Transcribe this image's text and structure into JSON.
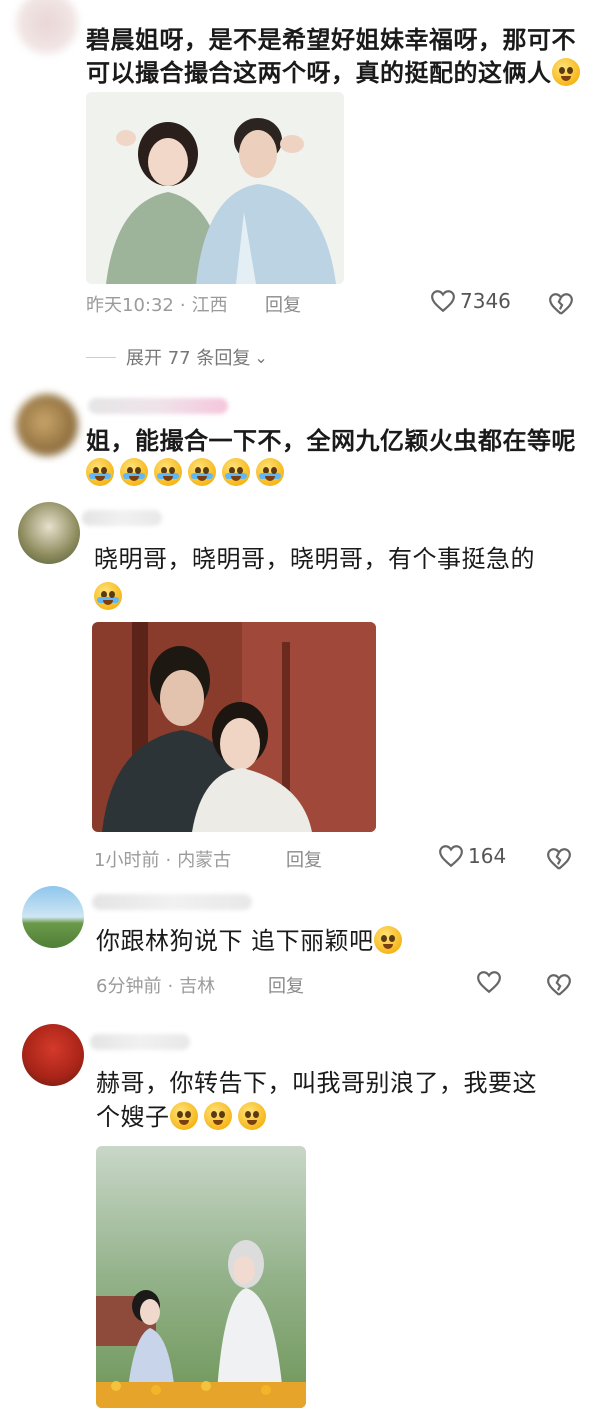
{
  "comments": [
    {
      "text": "碧晨姐呀，是不是希望好姐妹幸福呀，那可不可以撮合撮合这两个呀，真的挺配的这俩人",
      "line1": "碧晨姐呀，是不是希望好姐妹幸福呀，那可不",
      "line2": "可以撮合撮合这两个呀，真的挺配的这俩人",
      "time": "昨天10:32",
      "location": "江西",
      "reply_label": "回复",
      "likes": "7346",
      "expand_label": "展开 77 条回复",
      "emoji": "smile-emoji"
    },
    {
      "text": "姐，能撮合一下不，全网九亿颖火虫都在等呢",
      "emoji_count": 6,
      "emoji": "crying-laughing-emoji"
    },
    {
      "text": "晓明哥，晓明哥，晓明哥，有个事挺急的",
      "time": "1小时前",
      "location": "内蒙古",
      "reply_label": "回复",
      "likes": "164",
      "emoji": "crying-emoji"
    },
    {
      "text": "你跟林狗说下 追下丽颖吧",
      "time": "6分钟前",
      "location": "吉林",
      "reply_label": "回复",
      "likes": "",
      "emoji": "pleading-emoji"
    },
    {
      "text": "赫哥，你转告下，叫我哥别浪了，我要这个嫂子",
      "line1": "赫哥，你转告下，叫我哥别浪了，我要这",
      "line2": "个嫂子",
      "emoji": "pleading-emoji",
      "emoji_count": 3
    }
  ],
  "colors": {
    "meta": "#9b9b9b",
    "text": "#1a1a1a",
    "emoji": "#f6b81b"
  }
}
